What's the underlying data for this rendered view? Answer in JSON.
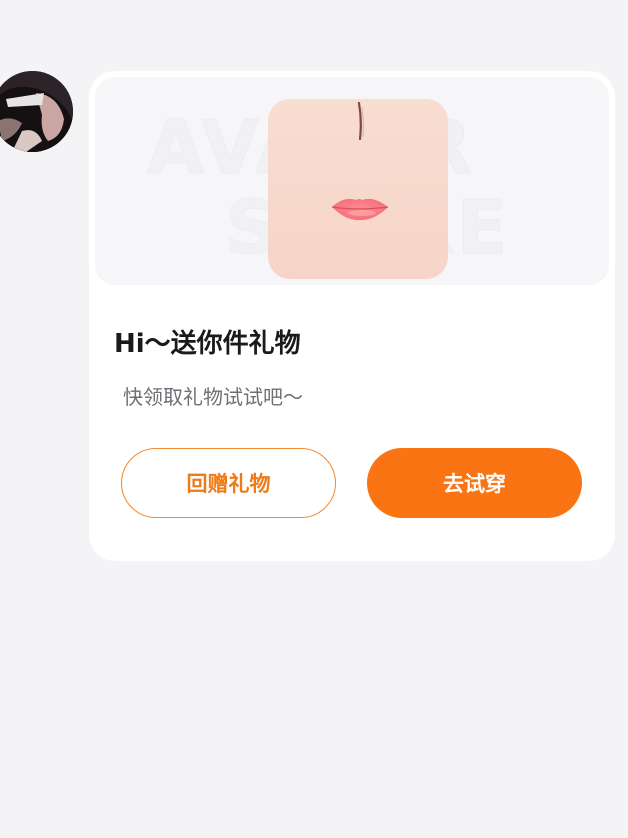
{
  "message": {
    "avatar_icon": "user-avatar",
    "card": {
      "banner": {
        "watermark_line1": "AVATAR",
        "watermark_line2": "STORE",
        "gift_image_icon": "makeup-face-thumbnail"
      },
      "title": "Hi～送你件礼物",
      "subtitle": "快领取礼物试试吧～",
      "buttons": {
        "return_gift_label": "回赠礼物",
        "try_on_label": "去试穿"
      }
    }
  },
  "colors": {
    "page_background": "#f4f3f6",
    "card_background": "#ffffff",
    "accent_orange": "#fa7414",
    "title_text": "#1a1a1a",
    "subtitle_text": "#6f6f75"
  }
}
